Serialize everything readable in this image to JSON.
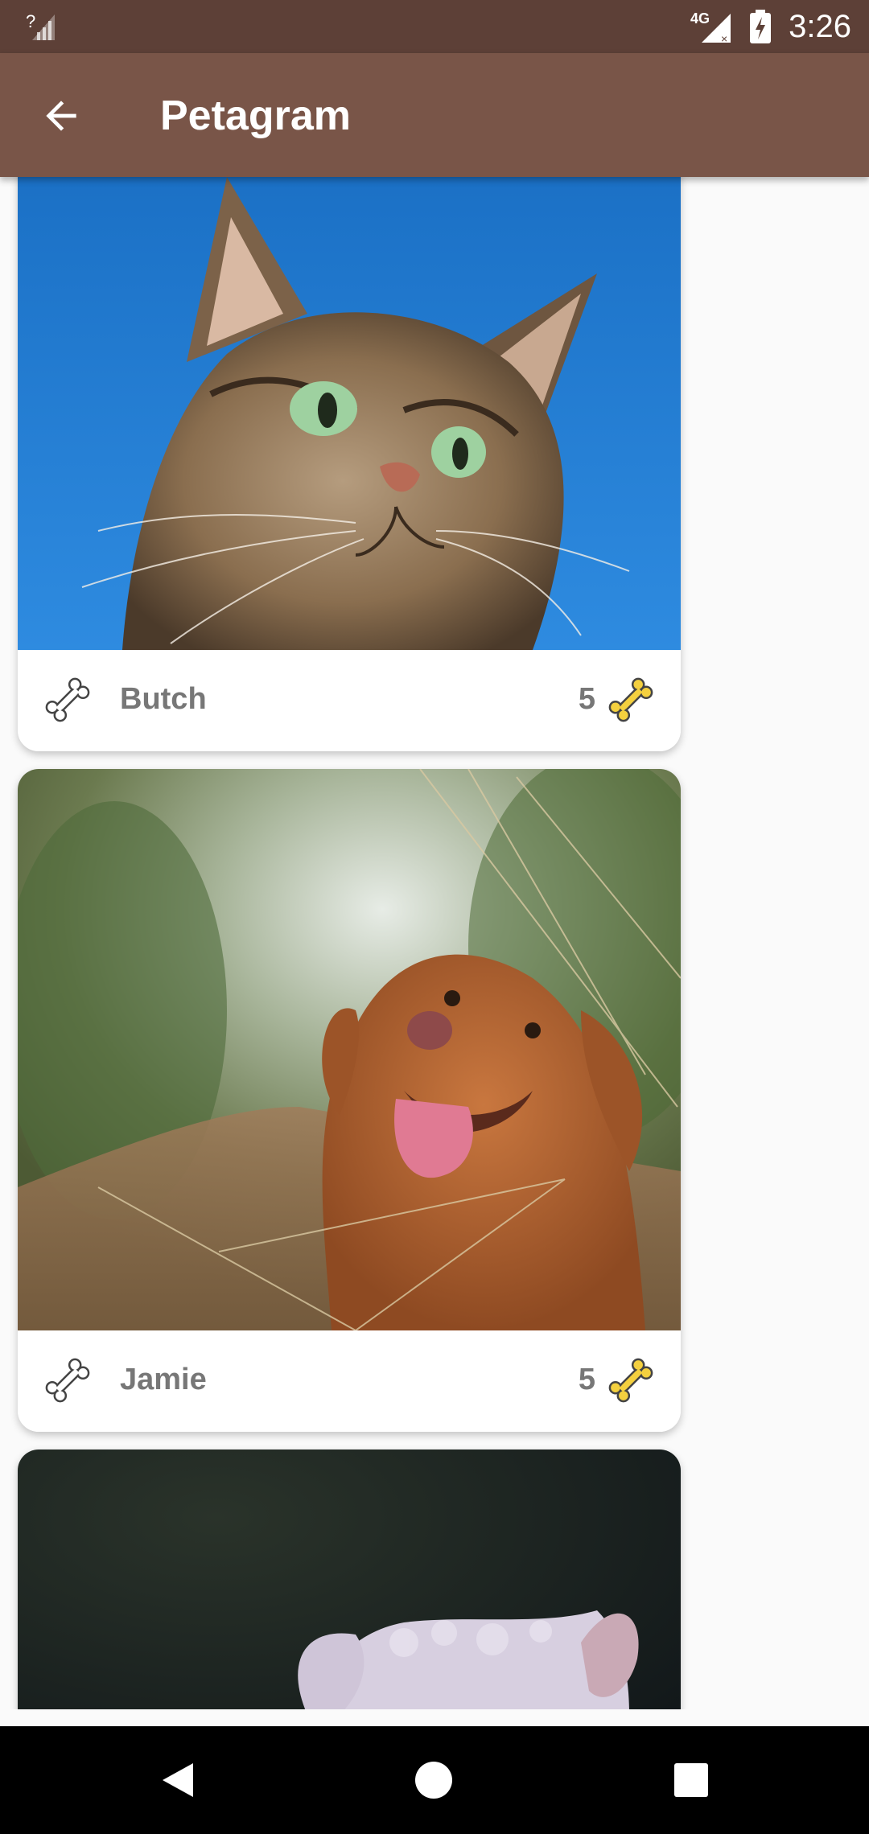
{
  "status_bar": {
    "time": "3:26",
    "network": "4G",
    "icons": [
      "no-sim-signal-icon",
      "4g-signal-icon",
      "battery-charging-icon"
    ]
  },
  "app_bar": {
    "title": "Petagram",
    "back_icon": "arrow-back-icon"
  },
  "pets": [
    {
      "name": "Butch",
      "likes": "5",
      "photo": "tabby-cat-photo",
      "rate_icon": "bone-outline-icon",
      "likes_icon": "bone-gold-icon"
    },
    {
      "name": "Jamie",
      "likes": "5",
      "photo": "brown-dog-photo",
      "rate_icon": "bone-outline-icon",
      "likes_icon": "bone-gold-icon"
    },
    {
      "name": "",
      "likes": "",
      "photo": "white-puppy-photo"
    }
  ],
  "colors": {
    "status_bar": "#5d4037",
    "app_bar": "#795548",
    "background": "#fafafa",
    "bone_gold": "#f4d03f"
  },
  "nav_bar": {
    "icons": [
      "back-triangle-icon",
      "home-circle-icon",
      "recents-square-icon"
    ]
  }
}
